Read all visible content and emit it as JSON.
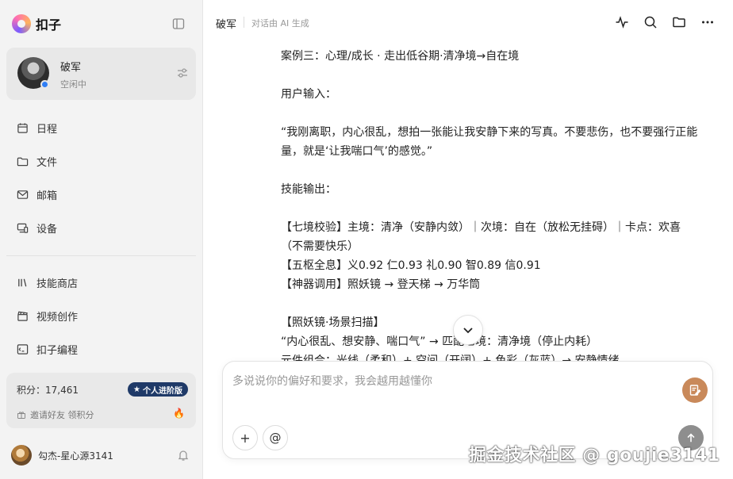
{
  "app": {
    "name": "扣子"
  },
  "profile": {
    "name": "破军",
    "status": "空闲中"
  },
  "nav": {
    "primary": [
      {
        "label": "日程",
        "icon": "calendar-icon"
      },
      {
        "label": "文件",
        "icon": "folder-icon"
      },
      {
        "label": "邮箱",
        "icon": "mail-icon"
      },
      {
        "label": "设备",
        "icon": "device-icon"
      }
    ],
    "secondary": [
      {
        "label": "技能商店",
        "icon": "store-icon"
      },
      {
        "label": "视频创作",
        "icon": "clapper-icon"
      },
      {
        "label": "扣子编程",
        "icon": "code-icon"
      }
    ]
  },
  "points": {
    "label": "积分：17,461",
    "badge": "个人进阶版",
    "invite": "邀请好友 领积分"
  },
  "user": {
    "name": "勾杰-星心源3141"
  },
  "header": {
    "title": "破军",
    "subtitle": "对话由 AI 生成"
  },
  "message": {
    "case_title": "案例三：心理/成长 · 走出低谷期·清净境→自在境",
    "input_label": "用户输入：",
    "input_text": "“我刚离职，内心很乱，想拍一张能让我安静下来的写真。不要悲伤，也不要强行正能量，就是‘让我喘口气’的感觉。”",
    "output_label": "技能输出：",
    "line_qijing": "【七境校验】主境：清净（安静内敛）｜次境：自在（放松无挂碍）｜卡点：欢喜（不需要快乐）",
    "line_wushu": "【五枢全息】义0.92 仁0.93 礼0.90 智0.89 信0.91",
    "line_shenqi": "【神器调用】照妖镜 → 登天梯 → 万华筒",
    "scan_title": "【照妖镜·场景扫描】",
    "scan_line1": "“内心很乱、想安静、喘口气” → 匹配七境：清净境（停止内耗）",
    "scan_line2": "元件组合：光线（柔和）+ 空间（开阔）+ 色彩（灰蓝）→ 安静情绪"
  },
  "composer": {
    "placeholder": "多说说你的偏好和要求，我会越用越懂你",
    "add_label": "+",
    "at_label": "@"
  },
  "watermark": "掘金技术社区 @ goujie3141",
  "colors": {
    "accent_badge": "#1f3a68",
    "status_dot": "#2f7ef5",
    "prompt_button": "#c9895a",
    "send_button": "#8e8e8e"
  }
}
